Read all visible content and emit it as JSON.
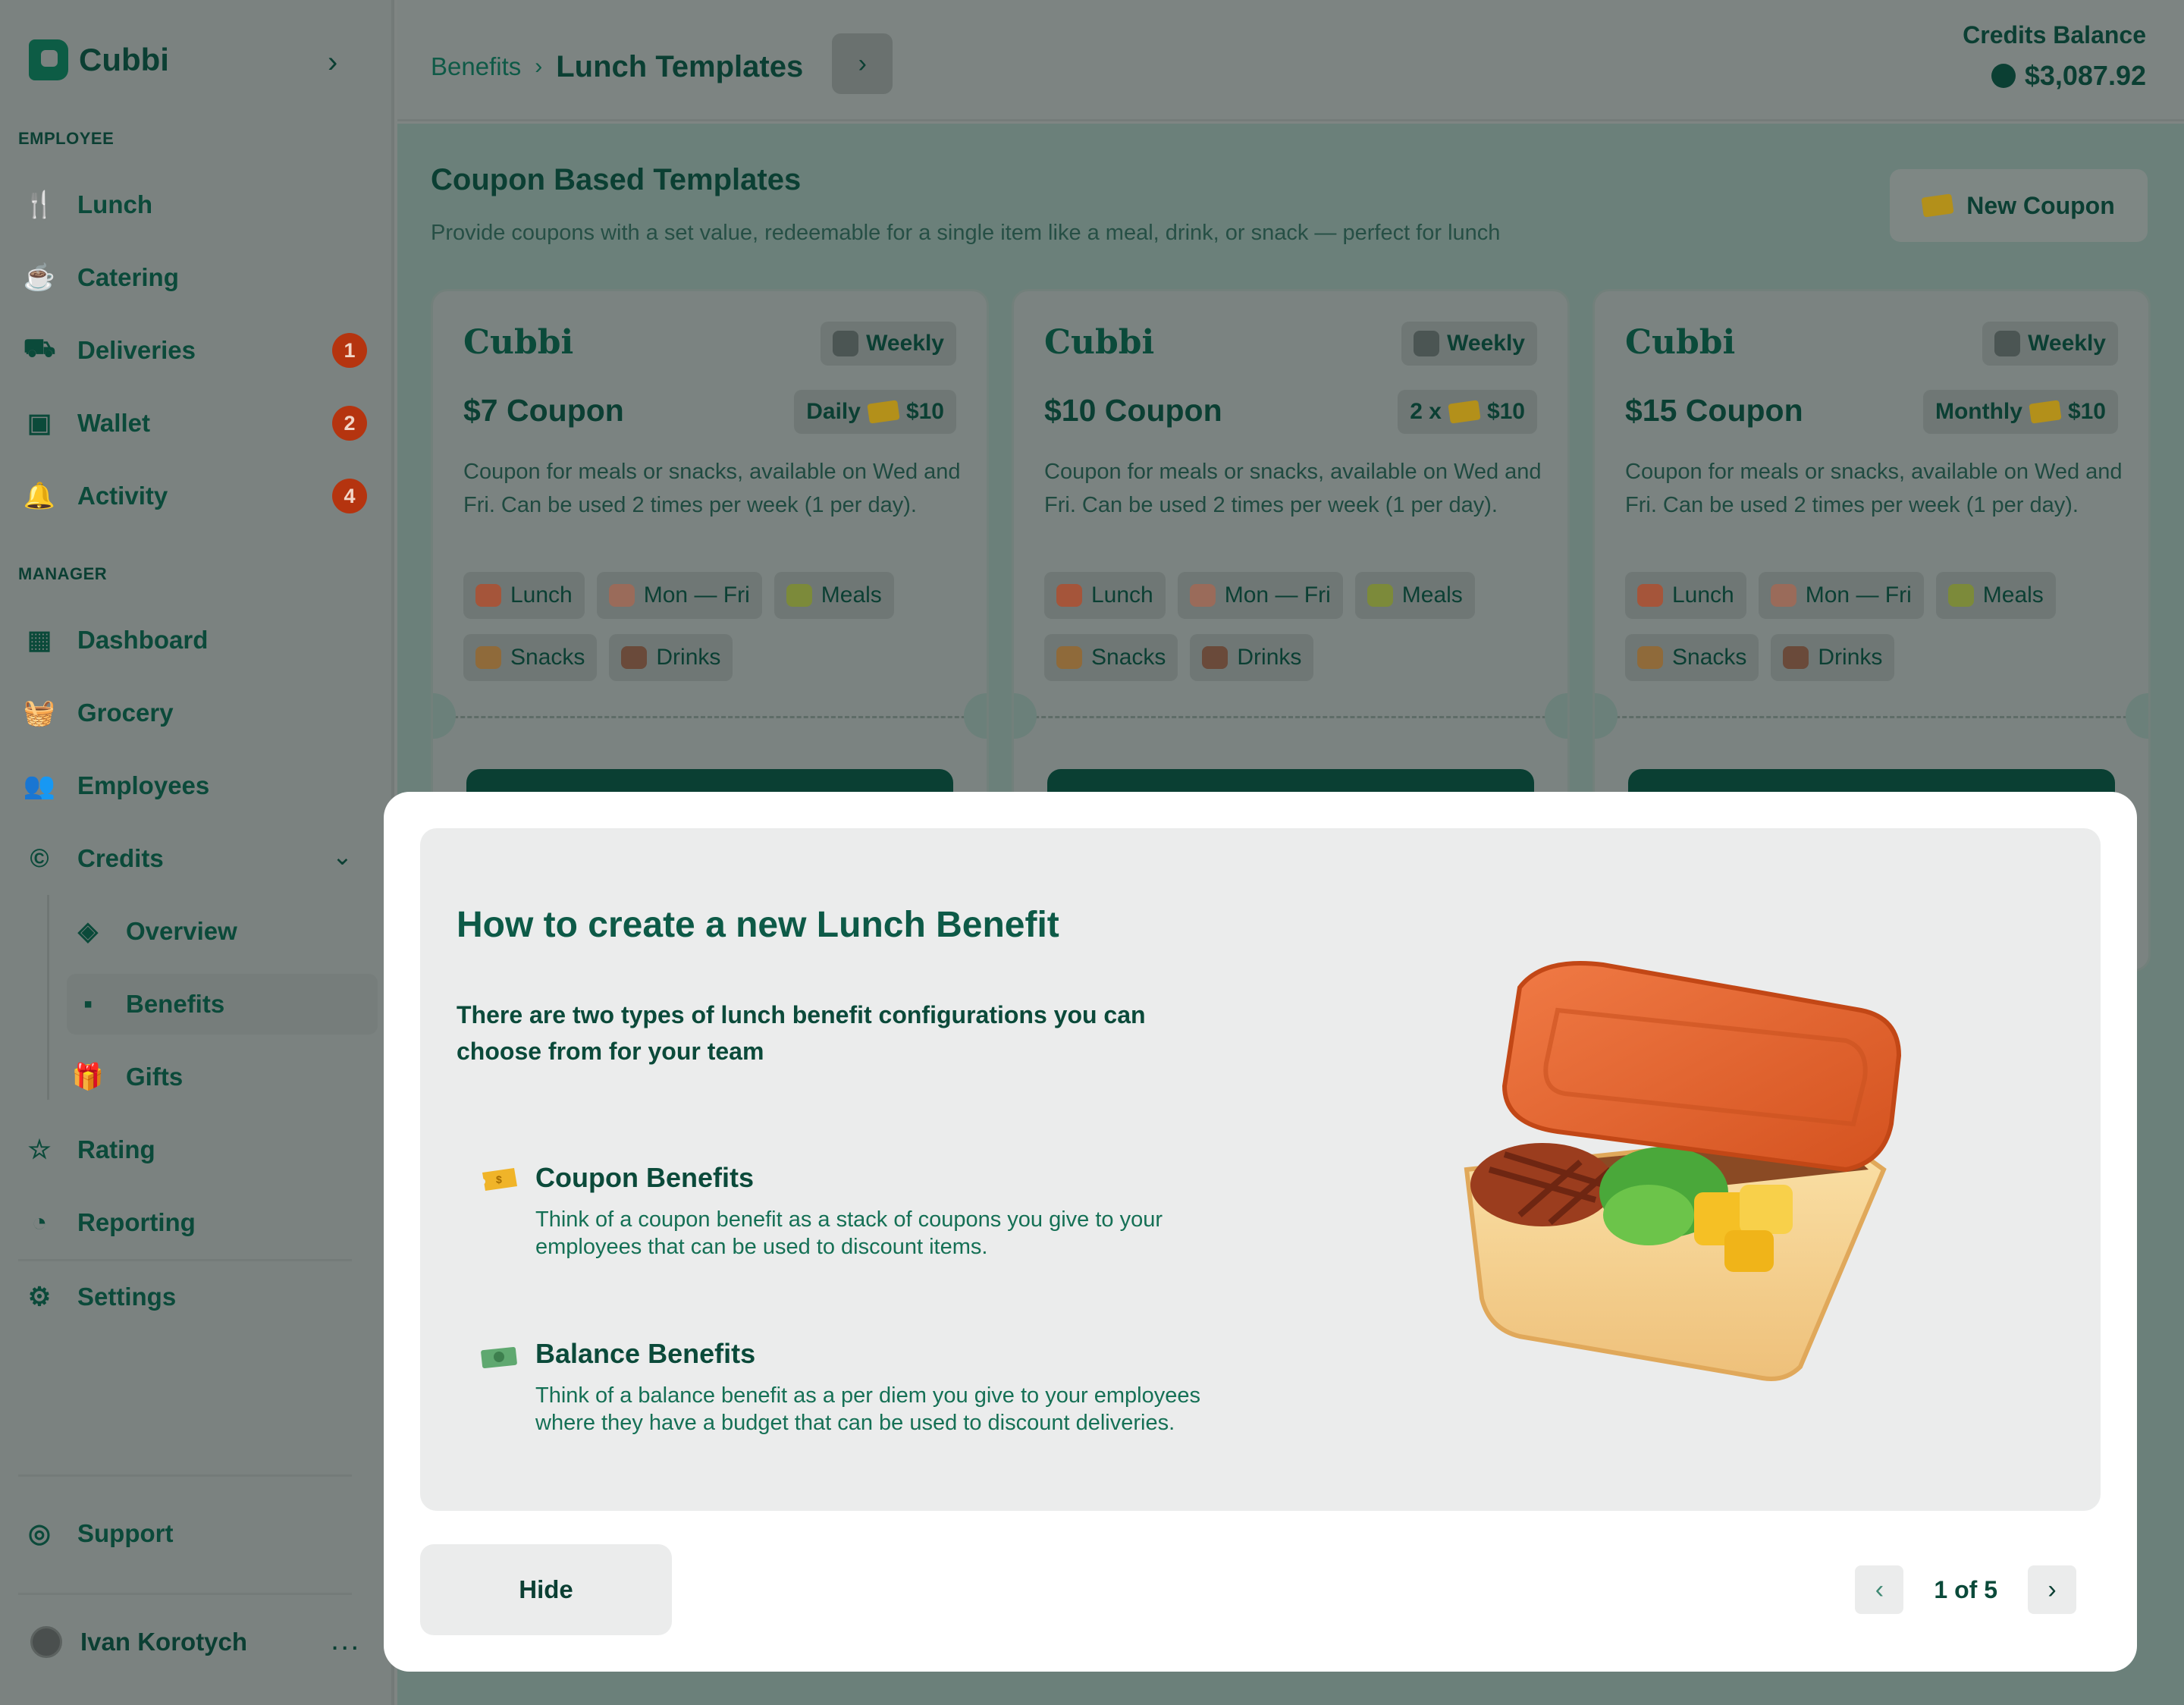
{
  "app": {
    "name": "Cubbi"
  },
  "sidebar": {
    "employee_label": "EMPLOYEE",
    "manager_label": "MANAGER",
    "employee_items": [
      {
        "label": "Lunch",
        "icon": "fork-knife-icon"
      },
      {
        "label": "Catering",
        "icon": "catering-icon"
      },
      {
        "label": "Deliveries",
        "icon": "truck-icon",
        "badge": "1"
      },
      {
        "label": "Wallet",
        "icon": "wallet-icon",
        "badge": "2"
      },
      {
        "label": "Activity",
        "icon": "bell-icon",
        "badge": "4"
      }
    ],
    "manager_items": [
      {
        "label": "Dashboard",
        "icon": "grid-icon"
      },
      {
        "label": "Grocery",
        "icon": "basket-icon"
      },
      {
        "label": "Employees",
        "icon": "users-icon"
      },
      {
        "label": "Credits",
        "icon": "coin-icon"
      }
    ],
    "credits_sub": [
      {
        "label": "Overview",
        "icon": "layers-icon"
      },
      {
        "label": "Benefits",
        "icon": "benefit-icon"
      },
      {
        "label": "Gifts",
        "icon": "gift-icon"
      }
    ],
    "bottom_items": [
      {
        "label": "Rating",
        "icon": "star-icon"
      },
      {
        "label": "Reporting",
        "icon": "pie-chart-icon"
      },
      {
        "label": "Settings",
        "icon": "gear-icon"
      }
    ],
    "support": "Support",
    "user_name": "Ivan Korotych",
    "more": "..."
  },
  "header": {
    "breadcrumb_parent": "Benefits",
    "breadcrumb_current": "Lunch Templates",
    "balance_label": "Credits Balance",
    "balance_value": "$3,087.92"
  },
  "main": {
    "section_title": "Coupon Based Templates",
    "section_desc": "Provide coupons with a set value, redeemable for a single item like a meal, drink, or snack — perfect for lunch",
    "new_coupon_label": "New Coupon",
    "cards": [
      {
        "brand": "Cubbi",
        "period": "Weekly",
        "title": "$7 Coupon",
        "freq": "Daily",
        "amount": "$10",
        "desc": "Coupon for meals or snacks, available on Wed and Fri. Can be used 2 times per week (1 per day).",
        "tags": [
          "Lunch",
          "Mon — Fri",
          "Meals",
          "Snacks",
          "Drinks"
        ]
      },
      {
        "brand": "Cubbi",
        "period": "Weekly",
        "title": "$10 Coupon",
        "freq": "2 x",
        "amount": "$10",
        "desc": "Coupon for meals or snacks, available on Wed and Fri. Can be used 2 times per week (1 per day).",
        "tags": [
          "Lunch",
          "Mon — Fri",
          "Meals",
          "Snacks",
          "Drinks"
        ]
      },
      {
        "brand": "Cubbi",
        "period": "Weekly",
        "title": "$15 Coupon",
        "freq": "Monthly",
        "amount": "$10",
        "desc": "Coupon for meals or snacks, available on Wed and Fri. Can be used 2 times per week (1 per day).",
        "tags": [
          "Lunch",
          "Mon — Fri",
          "Meals",
          "Snacks",
          "Drinks"
        ]
      }
    ]
  },
  "modal": {
    "title": "How to create a new Lunch Benefit",
    "intro": "There are two types of lunch benefit configurations you can choose from for your team",
    "options": [
      {
        "title": "Coupon Benefits",
        "desc": "Think of a coupon benefit as a stack of coupons you give to your employees that can be used to discount items.",
        "icon": "coupon-icon"
      },
      {
        "title": "Balance Benefits",
        "desc": "Think of a balance benefit as a per diem you give to your employees where they have a budget that can be used to discount deliveries.",
        "icon": "money-icon"
      }
    ],
    "hide_label": "Hide",
    "pager": {
      "current": "1",
      "of": "of",
      "total": "5"
    }
  },
  "colors": {
    "brand": "#0d5a47",
    "badge": "#c43a12",
    "coupon": "#f0b429",
    "lid": "#e2622f"
  }
}
